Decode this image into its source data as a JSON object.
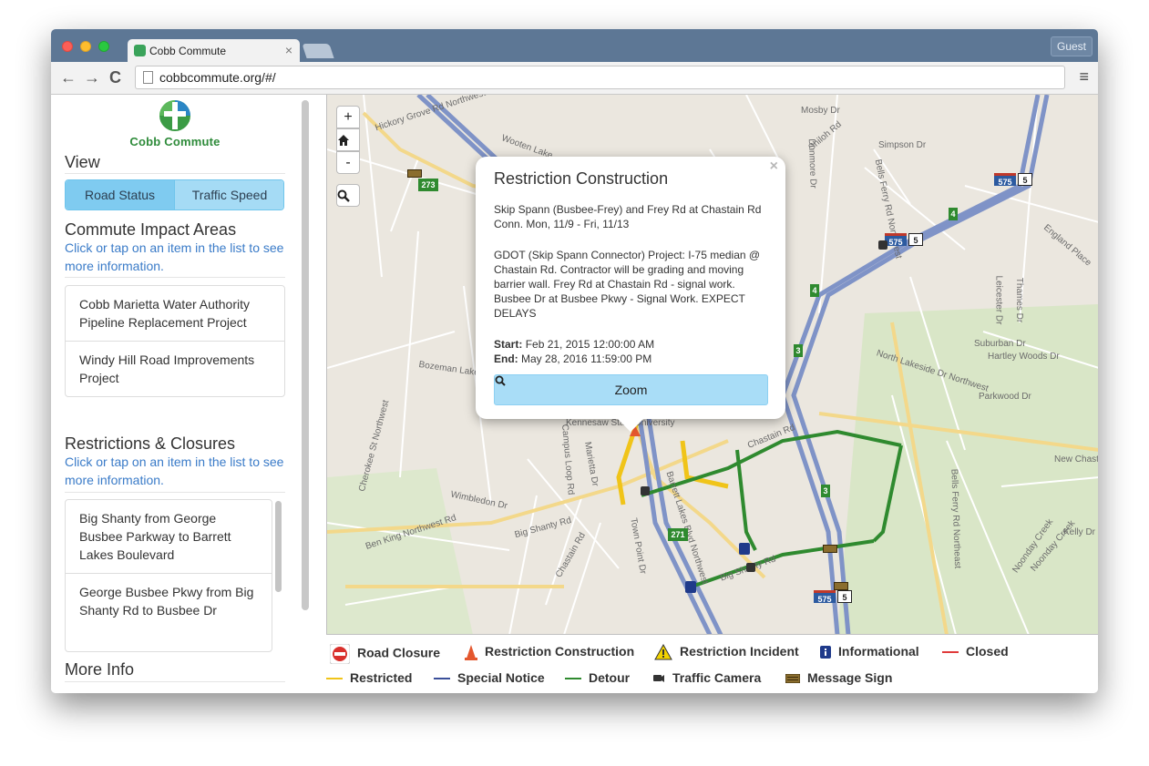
{
  "browser": {
    "tab_title": "Cobb Commute",
    "tab_close": "×",
    "url": "cobbcommute.org/#/",
    "guest_label": "Guest",
    "back": "←",
    "forward": "→",
    "reload": "C",
    "menu": "≡"
  },
  "sidebar": {
    "logo_text": "Cobb Commute",
    "view_heading": "View",
    "view_buttons": [
      "Road Status",
      "Traffic Speed"
    ],
    "impact_heading": "Commute Impact Areas",
    "impact_note": "Click or tap on an item in the list to see more information.",
    "impact_items": [
      "Cobb Marietta Water Authority Pipeline Replacement Project",
      "Windy Hill Road Improvements Project"
    ],
    "restrictions_heading": "Restrictions & Closures",
    "restrictions_note": "Click or tap on an item in the list to see more information.",
    "restriction_items": [
      "Big Shanty from George Busbee Parkway to Barrett Lakes Boulevard",
      "George Busbee Pkwy from Big Shanty Rd to Busbee Dr"
    ],
    "more_info_heading": "More Info"
  },
  "map": {
    "zoom_in": "+",
    "zoom_out": "-",
    "labels": [
      "Hickory Grove Rd Northwest",
      "Wooten Lake",
      "Mosby Dr",
      "Shiloh Rd",
      "Simpson Dr",
      "Bells Ferry Rd Northwest",
      "Chastain Rd",
      "Kennesaw State University",
      "Town Point Dr",
      "Chastain Rd",
      "Big Shanty Rd",
      "Ben King Northwest Rd",
      "Cherokee St Northwest",
      "Wimbledon Dr",
      "Barrett Lakes Blvd Northwest",
      "Big Shanty Rd",
      "Bells Ferry Rd Northeast",
      "New Chastain Rd",
      "Noonday Creek",
      "Parkwood Dr",
      "Suburban Dr",
      "North Lakeside Dr Northwest",
      "England Place",
      "Leicester Dr",
      "Bozeman Lake Rd Northwest",
      "Campus Loop Rd",
      "Marietta Dr",
      "Kelly Dr",
      "Noonday Creek",
      "Hartley Woods Dr",
      "Thames Dr",
      "Dunmore Dr"
    ],
    "shields": [
      "273",
      "575",
      "5",
      "575",
      "5",
      "4",
      "4",
      "3",
      "3",
      "271",
      "575",
      "5"
    ]
  },
  "popup": {
    "title": "Restriction Construction",
    "close": "×",
    "line1": "Skip Spann (Busbee-Frey) and Frey Rd at Chastain Rd Conn. Mon, 11/9 - Fri, 11/13",
    "line2": "GDOT (Skip Spann Connector) Project: I-75 median @ Chastain Rd. Contractor will be grading and moving barrier wall. Frey Rd at Chastain Rd - signal work. Busbee Dr at Busbee Pkwy - Signal Work. EXPECT DELAYS",
    "start_label": "Start:",
    "start_value": "Feb 21, 2015 12:00:00 AM",
    "end_label": "End:",
    "end_value": "May 28, 2016 11:59:00 PM",
    "zoom_label": "Zoom"
  },
  "legend": {
    "items": [
      "Road Closure",
      "Restriction Construction",
      "Restriction Incident",
      "Informational",
      "Closed",
      "Restricted",
      "Special Notice",
      "Detour",
      "Traffic Camera",
      "Message Sign"
    ],
    "colors": {
      "closed": "#e03a3a",
      "restricted": "#f0c419",
      "special_notice": "#3a4f9a",
      "detour": "#2f8a2f"
    }
  }
}
